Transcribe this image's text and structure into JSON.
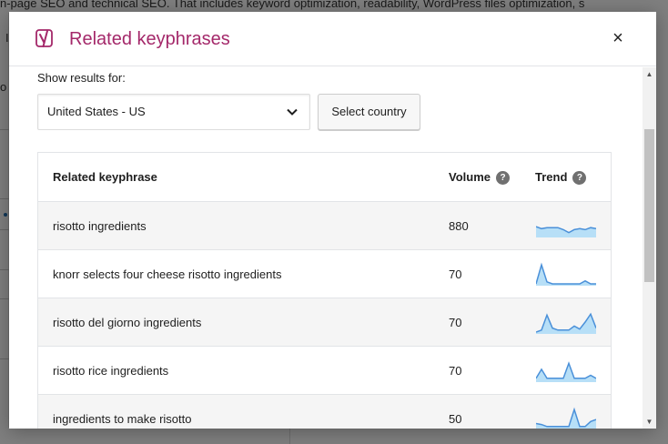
{
  "background": {
    "text": "n-page SEO and technical SEO. That includes keyword optimization, readability, WordPress files optimization, s",
    "fragment_1": "I",
    "fragment_2": "o"
  },
  "modal": {
    "title": "Related keyphrases",
    "logo_icon": "yoast-logo-icon",
    "close_label": "×",
    "show_results_label": "Show results for:",
    "country_value": "United States - US",
    "select_country_label": "Select country",
    "accent_color": "#a4286a",
    "trend_color": "#4a90d9",
    "trend_fill": "#b7dff7"
  },
  "table": {
    "headers": {
      "keyphrase": "Related keyphrase",
      "volume": "Volume",
      "trend": "Trend",
      "help_icon_label": "?"
    },
    "rows": [
      {
        "keyphrase": "risotto ingredients",
        "volume": "880",
        "trend": [
          0.45,
          0.35,
          0.4,
          0.4,
          0.4,
          0.3,
          0.15,
          0.3,
          0.35,
          0.3,
          0.4,
          0.35
        ]
      },
      {
        "keyphrase": "knorr selects four cheese risotto ingredients",
        "volume": "70",
        "trend": [
          0.0,
          0.95,
          0.1,
          0.0,
          0.0,
          0.0,
          0.0,
          0.0,
          0.0,
          0.15,
          0.0,
          0.0
        ]
      },
      {
        "keyphrase": "risotto del giorno ingredients",
        "volume": "70",
        "trend": [
          0.0,
          0.1,
          0.85,
          0.2,
          0.1,
          0.1,
          0.1,
          0.3,
          0.15,
          0.5,
          0.9,
          0.2
        ]
      },
      {
        "keyphrase": "risotto rice ingredients",
        "volume": "70",
        "trend": [
          0.1,
          0.55,
          0.1,
          0.1,
          0.1,
          0.1,
          0.85,
          0.1,
          0.1,
          0.1,
          0.25,
          0.1
        ]
      },
      {
        "keyphrase": "ingredients to make risotto",
        "volume": "50",
        "trend": [
          0.25,
          0.2,
          0.1,
          0.1,
          0.1,
          0.1,
          0.1,
          0.95,
          0.1,
          0.1,
          0.35,
          0.45
        ]
      }
    ]
  },
  "scrollbar": {
    "up_glyph": "▲",
    "down_glyph": "▼"
  }
}
